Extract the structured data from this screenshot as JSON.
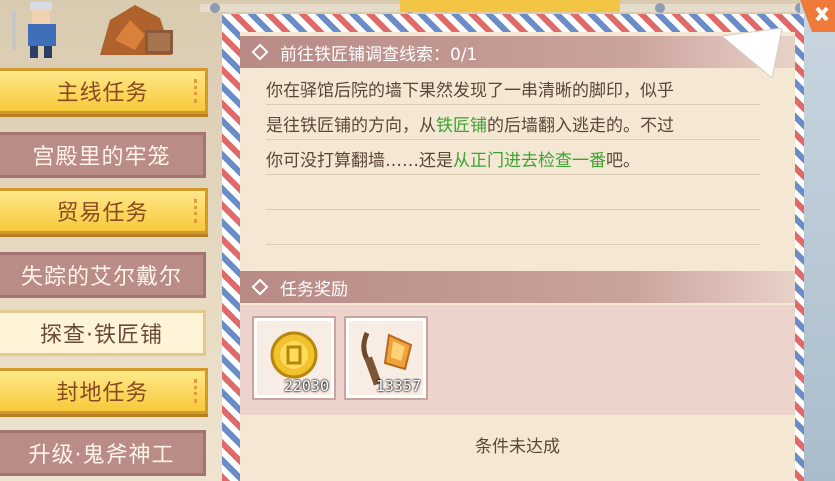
{
  "sidebar": {
    "tabs": [
      {
        "label": "主线任务",
        "kind": "category"
      },
      {
        "label": "宫殿里的牢笼",
        "kind": "quest"
      },
      {
        "label": "贸易任务",
        "kind": "category"
      },
      {
        "label": "失踪的艾尔戴尔",
        "kind": "quest"
      },
      {
        "label": "探查·铁匠铺",
        "kind": "quest-selected"
      },
      {
        "label": "封地任务",
        "kind": "category"
      },
      {
        "label": "升级·鬼斧神工",
        "kind": "quest"
      }
    ]
  },
  "quest": {
    "objective_title": "前往铁匠铺调查线索：0/1",
    "desc_line1": "你在驿馆后院的墙下果然发现了一串清晰的脚印，似乎",
    "desc_line2_a": "是往铁匠铺的方向，从",
    "desc_line2_b": "铁匠铺",
    "desc_line2_c": "的后墙翻入逃走的。不过",
    "desc_line3_a": "你可没打算翻墙……还是",
    "desc_line3_b": "从正门进去检查一番",
    "desc_line3_c": "吧。"
  },
  "rewards": {
    "title": "任务奖励",
    "items": [
      {
        "icon": "gold-coin-icon",
        "count": "22030"
      },
      {
        "icon": "pickaxe-icon",
        "count": "13357"
      }
    ]
  },
  "status": "条件未达成",
  "colors": {
    "highlight": "#3da331",
    "category_tab": "#f6c93a",
    "quest_tab": "#b98c87"
  }
}
